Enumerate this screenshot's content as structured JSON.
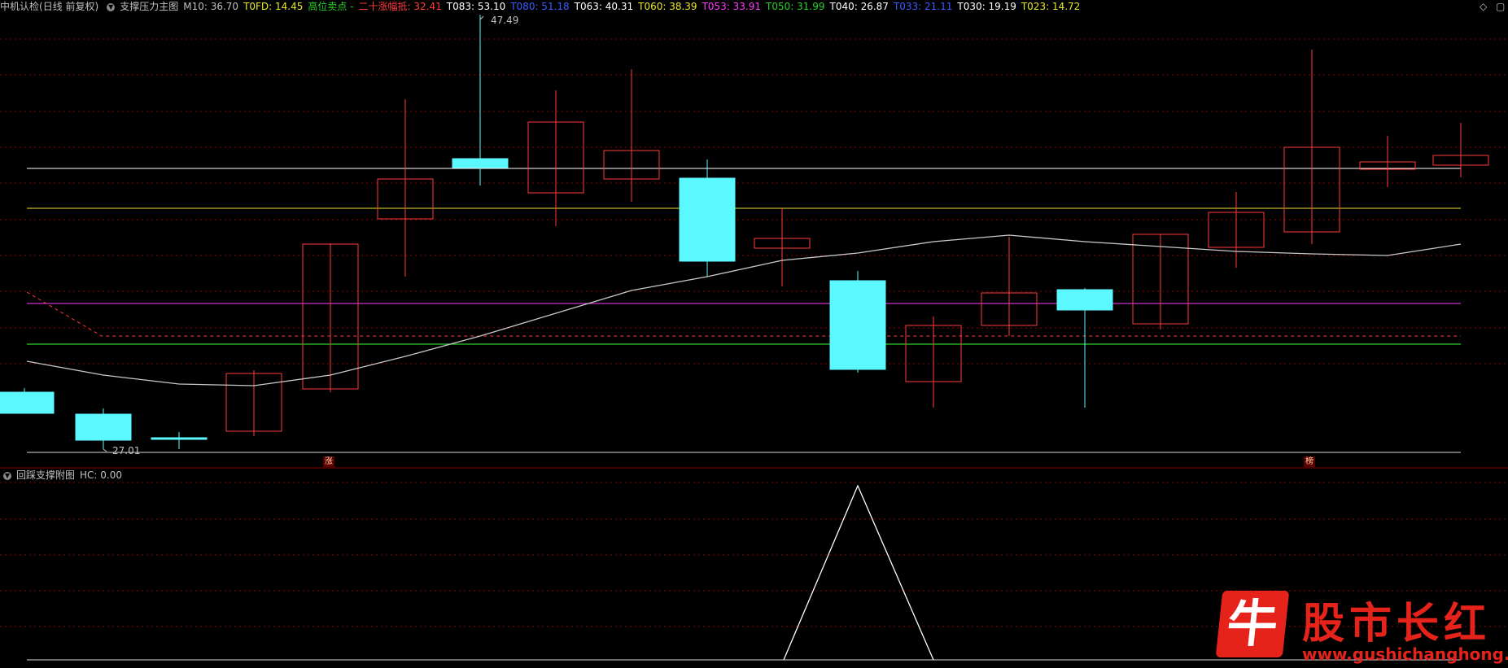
{
  "header": {
    "stock_name": "中机认检",
    "period_mode": "(日线 前复权)",
    "indicator_name": "支撑压力主图",
    "items": [
      {
        "label": "M10: 36.70",
        "color": "#c0c0c0"
      },
      {
        "label": "T0FD: 14.45",
        "color": "#e8e82a"
      },
      {
        "label": "高位卖点 -",
        "color": "#2ad02a"
      },
      {
        "label": "二十涨幅抵: 32.41",
        "color": "#ff3b3b"
      },
      {
        "label": "T083: 53.10",
        "color": "#ffffff"
      },
      {
        "label": "T080: 51.18",
        "color": "#3a5cff"
      },
      {
        "label": "T063: 40.31",
        "color": "#ffffff"
      },
      {
        "label": "T060: 38.39",
        "color": "#e8e82a"
      },
      {
        "label": "T053: 33.91",
        "color": "#ff3bff"
      },
      {
        "label": "T050: 31.99",
        "color": "#2ad02a"
      },
      {
        "label": "T040: 26.87",
        "color": "#ffffff"
      },
      {
        "label": "T033: 21.11",
        "color": "#3a5cff"
      },
      {
        "label": "T030: 19.19",
        "color": "#ffffff"
      },
      {
        "label": "T023: 14.72",
        "color": "#e8e82a"
      }
    ]
  },
  "main_chart": {
    "high_label": "47.49",
    "low_label": "27.01",
    "markers": [
      "涨",
      "榜"
    ]
  },
  "sub_chart": {
    "title": "回踩支撑附图",
    "value": "HC: 0.00"
  },
  "watermark": {
    "logo_char": "牛",
    "title": "股市长红",
    "url": "www.gushichanghong.com"
  },
  "colors": {
    "up": "#ff3b3b",
    "down": "#5cf8ff",
    "grid": "#8b0000",
    "ma": "#c8c8c8"
  }
}
